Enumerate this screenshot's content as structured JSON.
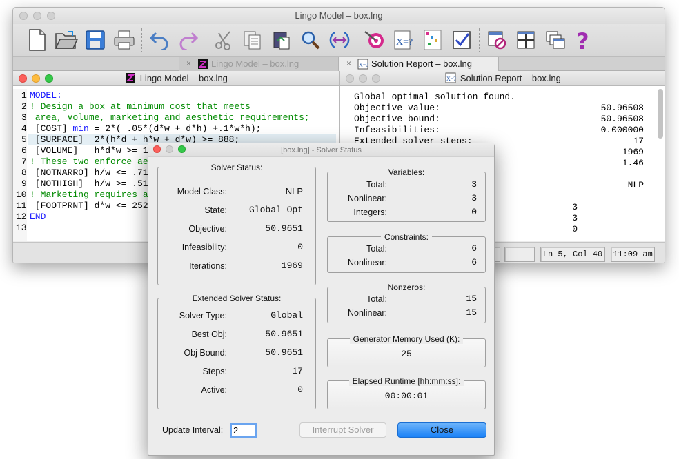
{
  "main_window": {
    "title": "Lingo Model – box.lng",
    "toolbar": [
      "new-file-icon",
      "open-folder-icon",
      "save-icon",
      "print-icon",
      "undo-icon",
      "redo-icon",
      "cut-icon",
      "copy-icon",
      "paste-icon",
      "find-icon",
      "goto-icon",
      "target-solve-icon",
      "solution-icon",
      "matrix-picture-icon",
      "check-icon",
      "close-all-icon",
      "tile-icon",
      "cascade-icon",
      "help-icon"
    ],
    "tabs": [
      {
        "close": "×",
        "label": "Lingo Model – box.lng"
      },
      {
        "close": "×",
        "label": "Solution Report – box.lng"
      }
    ]
  },
  "model_pane": {
    "title": "Lingo Model – box.lng",
    "line_numbers": [
      "1",
      "2",
      "3",
      "4",
      "5",
      "6",
      "7",
      "8",
      "9",
      "10",
      "11",
      "12",
      "13"
    ]
  },
  "code": {
    "l1": "MODEL:",
    "l2": "! Design a box at minimum cost that meets",
    "l3": " area, volume, marketing and aesthetic requirements;",
    "l4a": " [COST] ",
    "l4b": "min",
    "l4c": " = 2*( .05*(d*w + d*h) +.1*w*h);",
    "l5": " [SURFACE]  2*(h*d + h*w + d*w) >= 888;",
    "l6": " [VOLUME]   h*d*w >= 1",
    "l7": "! These two enforce ae",
    "l8": " [NOTNARRO] h/w <= .71",
    "l9": " [NOTHIGH]  h/w >= .51",
    "l10": "! Marketing requires a",
    "l11": " [FOOTPRNT] d*w <= 252",
    "l12": "END",
    "l13": ""
  },
  "report_pane": {
    "title": "Solution Report – box.lng",
    "lines": [
      {
        "label": "Global optimal solution found.",
        "value": ""
      },
      {
        "label": "Objective value:",
        "value": "50.96508"
      },
      {
        "label": "Objective bound:",
        "value": "50.96508"
      },
      {
        "label": "Infeasibilities:",
        "value": "0.000000"
      },
      {
        "label": "Extended solver steps:",
        "value": "17"
      },
      {
        "label": "",
        "value": "1969"
      },
      {
        "label": "",
        "value": "1.46"
      },
      {
        "label": "",
        "value": ""
      },
      {
        "label": "",
        "value": "NLP"
      },
      {
        "label": "",
        "value": "3"
      },
      {
        "label": "",
        "value": "3"
      },
      {
        "label": "",
        "value": "0"
      }
    ]
  },
  "status_bar": {
    "position": "Ln 5, Col 40",
    "time": "11:09 am"
  },
  "dialog": {
    "title": "[box.lng] - Solver Status",
    "solver_status": {
      "legend": "Solver Status:",
      "rows": [
        {
          "label": "Model Class:",
          "value": "NLP"
        },
        {
          "label": "State:",
          "value": "Global Opt"
        },
        {
          "label": "Objective:",
          "value": "50.9651"
        },
        {
          "label": "Infeasibility:",
          "value": "0"
        },
        {
          "label": "Iterations:",
          "value": "1969"
        }
      ]
    },
    "extended_status": {
      "legend": "Extended Solver Status:",
      "rows": [
        {
          "label": "Solver Type:",
          "value": "Global"
        },
        {
          "label": "Best Obj:",
          "value": "50.9651"
        },
        {
          "label": "Obj Bound:",
          "value": "50.9651"
        },
        {
          "label": "Steps:",
          "value": "17"
        },
        {
          "label": "Active:",
          "value": "0"
        }
      ]
    },
    "variables": {
      "legend": "Variables:",
      "rows": [
        {
          "label": "Total:",
          "value": "3"
        },
        {
          "label": "Nonlinear:",
          "value": "3"
        },
        {
          "label": "Integers:",
          "value": "0"
        }
      ]
    },
    "constraints": {
      "legend": "Constraints:",
      "rows": [
        {
          "label": "Total:",
          "value": "6"
        },
        {
          "label": "Nonlinear:",
          "value": "6"
        }
      ]
    },
    "nonzeros": {
      "legend": "Nonzeros:",
      "rows": [
        {
          "label": "Total:",
          "value": "15"
        },
        {
          "label": "Nonlinear:",
          "value": "15"
        }
      ]
    },
    "memory": {
      "legend": "Generator Memory Used (K):",
      "value": "25"
    },
    "runtime": {
      "legend": "Elapsed Runtime [hh:mm:ss]:",
      "value": "00:00:01"
    },
    "update_label": "Update Interval:",
    "update_value": "2",
    "interrupt_label": "Interrupt Solver",
    "close_label": "Close"
  }
}
